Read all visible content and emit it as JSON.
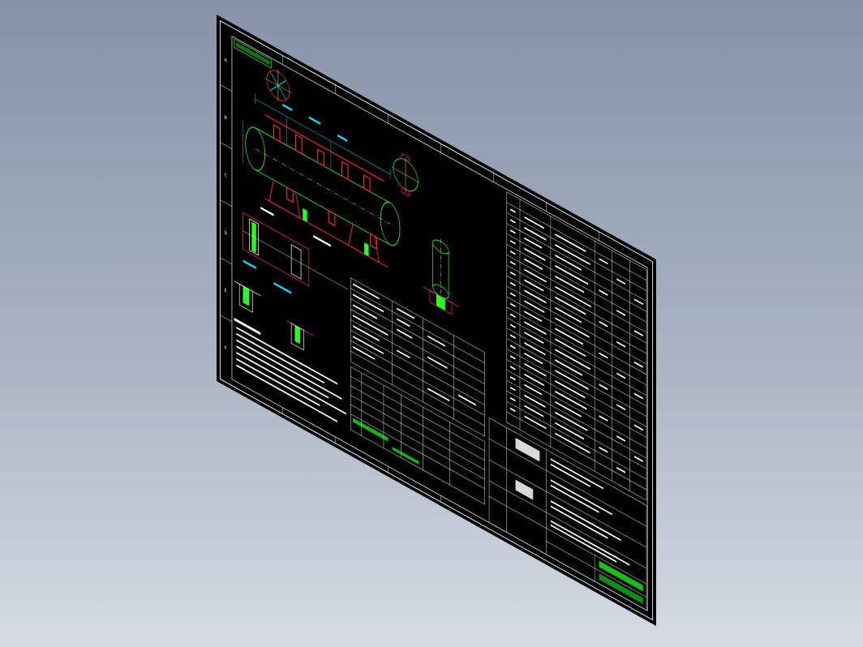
{
  "viewer": {
    "background_top": "#8592a8",
    "background_bottom": "#d6dbe3"
  },
  "drawing": {
    "sheet_color": "#000000",
    "frame_color": "#ffffff",
    "drawing_number": "",
    "zone_letters": [
      "A",
      "B",
      "C",
      "D",
      "E",
      "F"
    ],
    "colors": {
      "red": "#ff2a2a",
      "cyan": "#00e5ff",
      "green": "#22ff22",
      "yellow": "#ffff33",
      "magenta": "#ff33ff",
      "white": "#ffffff"
    }
  }
}
